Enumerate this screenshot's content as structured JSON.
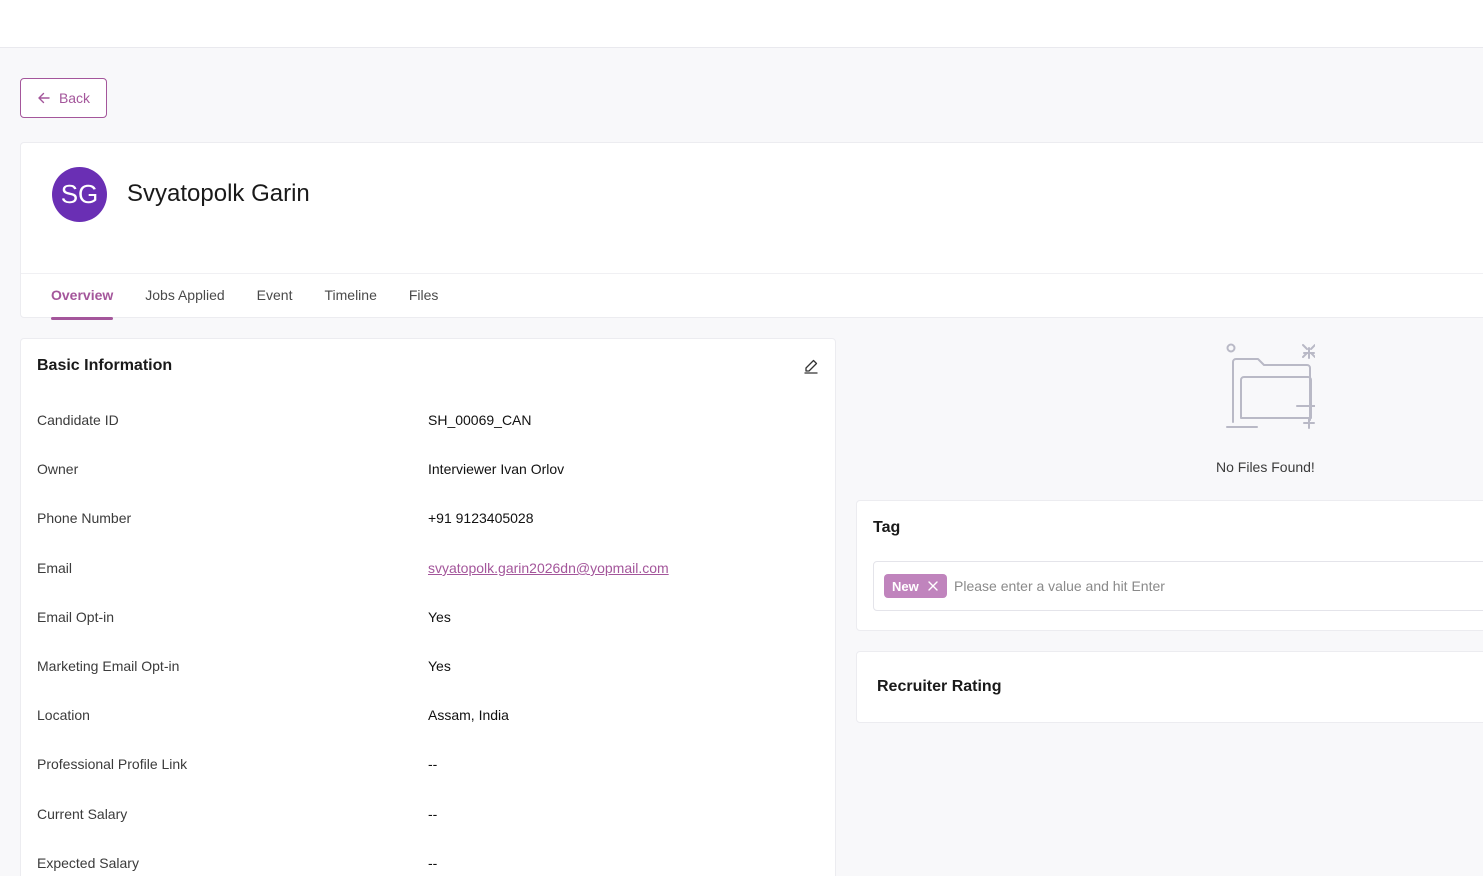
{
  "back_button": {
    "label": "Back"
  },
  "candidate": {
    "initials": "SG",
    "name": "Svyatopolk Garin",
    "avatar_color": "#6a2fb4"
  },
  "tabs": [
    {
      "label": "Overview",
      "active": true
    },
    {
      "label": "Jobs Applied",
      "active": false
    },
    {
      "label": "Event",
      "active": false
    },
    {
      "label": "Timeline",
      "active": false
    },
    {
      "label": "Files",
      "active": false
    }
  ],
  "basic_info": {
    "title": "Basic Information",
    "rows": [
      {
        "label": "Candidate ID",
        "value": "SH_00069_CAN"
      },
      {
        "label": "Owner",
        "value": "Interviewer Ivan Orlov"
      },
      {
        "label": "Phone Number",
        "value": "+91 9123405028"
      },
      {
        "label": "Email",
        "value": "svyatopolk.garin2026dn@yopmail.com"
      },
      {
        "label": "Email Opt-in",
        "value": "Yes"
      },
      {
        "label": "Marketing Email Opt-in",
        "value": "Yes"
      },
      {
        "label": "Location",
        "value": "Assam, India"
      },
      {
        "label": "Professional Profile Link",
        "value": "--"
      },
      {
        "label": "Current Salary",
        "value": "--"
      },
      {
        "label": "Expected Salary",
        "value": "--"
      }
    ]
  },
  "files": {
    "empty_text": "No Files Found!"
  },
  "tag": {
    "title": "Tag",
    "chips": [
      {
        "label": "New"
      }
    ],
    "placeholder": "Please enter a value and hit Enter"
  },
  "recruiter_rating": {
    "title": "Recruiter Rating"
  },
  "colors": {
    "accent": "#a4569b",
    "chip_bg": "#c084bd"
  }
}
